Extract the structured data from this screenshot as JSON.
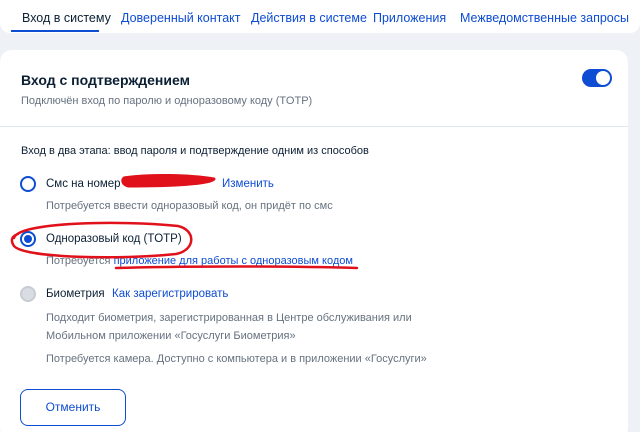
{
  "tabs": [
    {
      "label": "Вход в систему",
      "active": true
    },
    {
      "label": "Доверенный контакт"
    },
    {
      "label": "Действия в системе"
    },
    {
      "label": "Приложения"
    },
    {
      "label": "Межведомственные запросы"
    }
  ],
  "card": {
    "title": "Вход с подтверждением",
    "subtitle": "Подключён вход по паролю и одноразовому коду (TOTP)",
    "toggle_on": true,
    "intro": "Вход в два этапа: ввод пароля и подтверждение одним из способов",
    "options": {
      "sms": {
        "label": "Смс на номер",
        "action": "Изменить",
        "hint": "Потребуется ввести одноразовый код, он придёт по смс"
      },
      "totp": {
        "label": "Одноразовый код (TOTP)",
        "hint_prefix": "Потребуется",
        "hint_link": "приложение для работы с одноразовым кодом",
        "selected": true
      },
      "bio": {
        "label": "Биометрия",
        "action": "Как зарегистрировать",
        "hint_line1": "Подходит биометрия, зарегистрированная в Центре обслуживания или",
        "hint_line2": "Мобильном приложении «Госуслуги Биометрия»",
        "hint_camera": "Потребуется камера. Доступно с компьютера и в приложении «Госуслуги»",
        "disabled": true
      }
    },
    "cancel_label": "Отменить"
  },
  "colors": {
    "accent": "#0d4cd3",
    "annotation": "#e0111b",
    "text": "#0b1f33",
    "muted": "#66727f"
  }
}
